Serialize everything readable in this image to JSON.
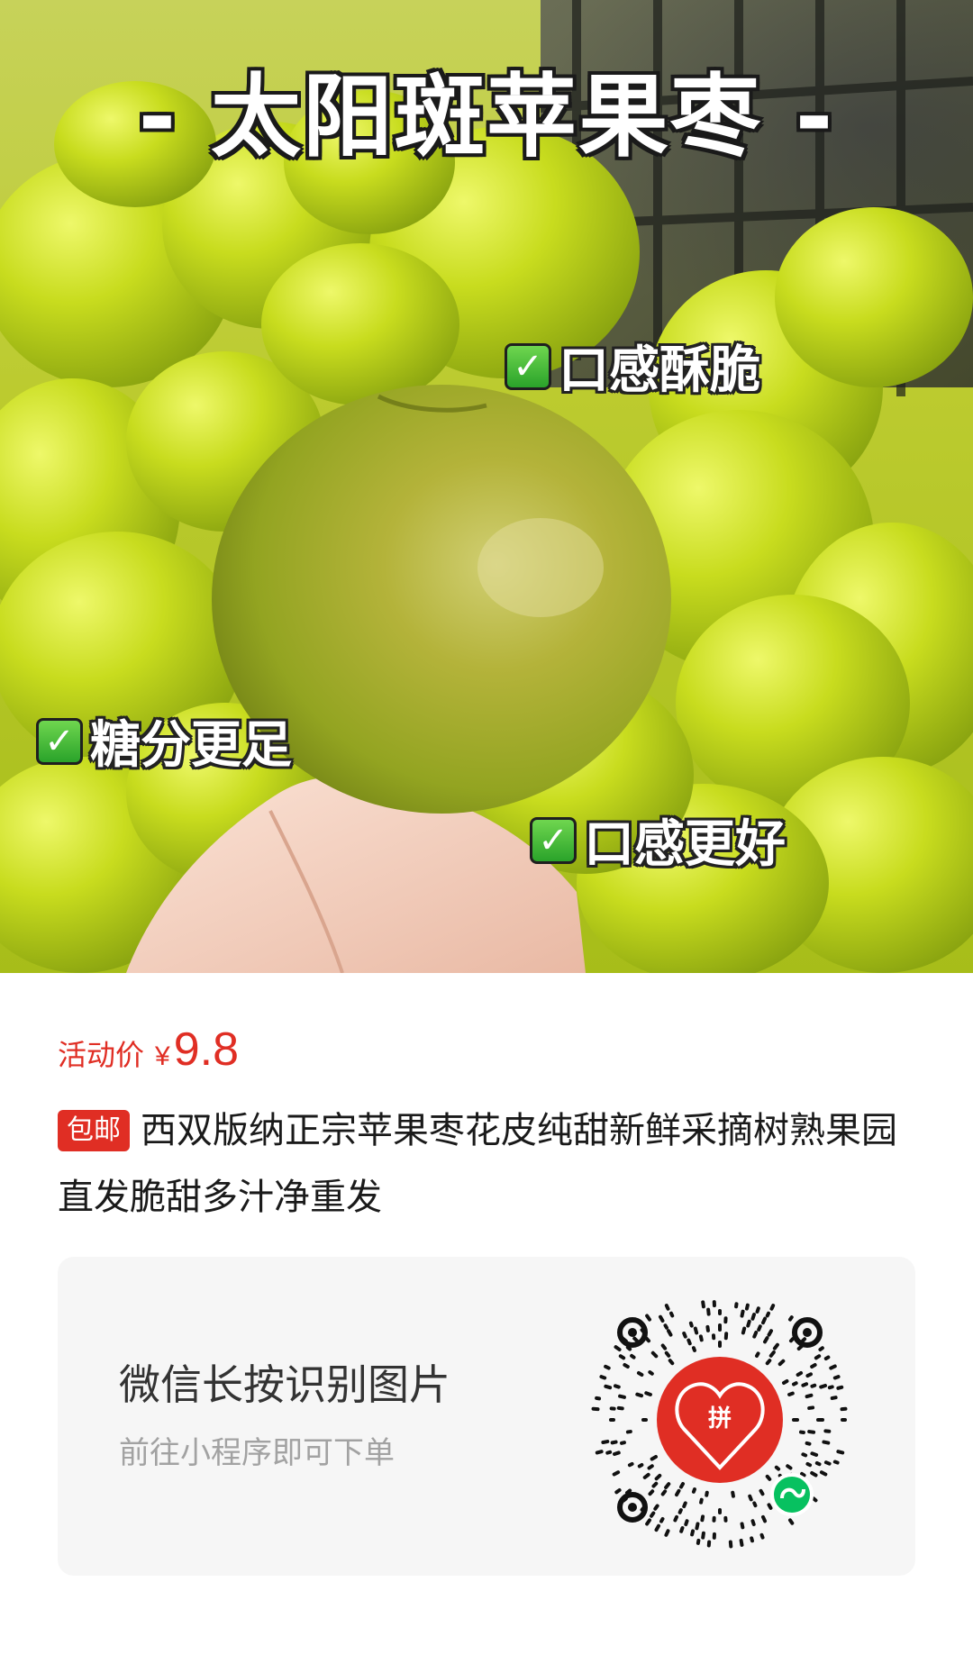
{
  "photo": {
    "title": "- 太阳斑苹果枣 -",
    "features": [
      {
        "label": "口感酥脆",
        "icon": "check-icon"
      },
      {
        "label": "糖分更足",
        "icon": "check-icon"
      },
      {
        "label": "口感更好",
        "icon": "check-icon"
      }
    ]
  },
  "price": {
    "label": "活动价",
    "currency": "¥",
    "value": "9.8",
    "color": "#e02e24"
  },
  "product": {
    "badge": "包邮",
    "title": "西双版纳正宗苹果枣花皮纯甜新鲜采摘树熟果园直发脆甜多汁净重发"
  },
  "qr_card": {
    "main_text": "微信长按识别图片",
    "sub_text": "前往小程序即可下单",
    "center_logo_char": "拼",
    "brand_color": "#e02e24",
    "mini_program_color": "#07c160"
  }
}
